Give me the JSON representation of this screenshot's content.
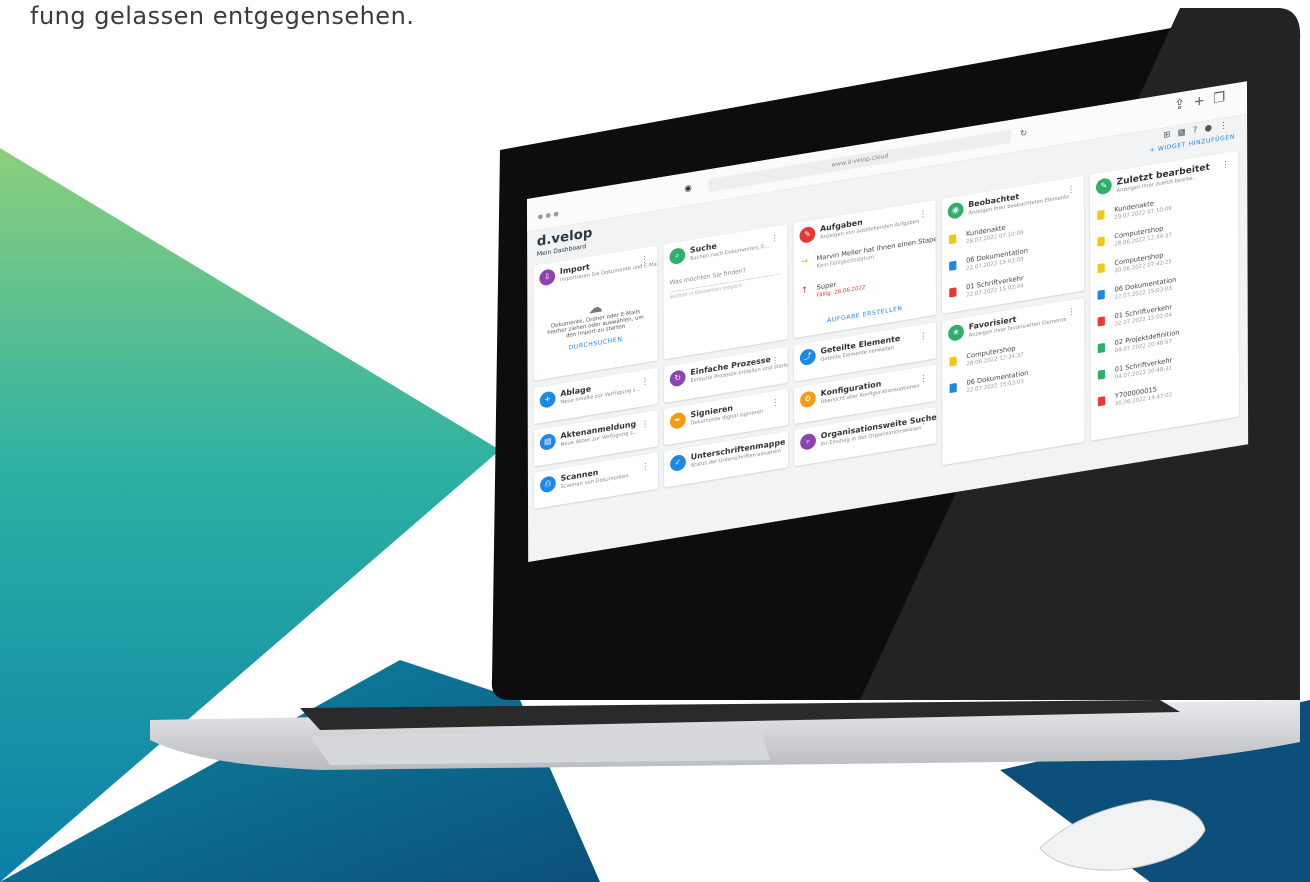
{
  "caption": "fung gelassen entgegensehen.",
  "browser": {
    "url": "www.d-velop.cloud",
    "icons": [
      "share-icon",
      "plus-icon",
      "tabs-icon"
    ]
  },
  "app": {
    "logo": "d.velop",
    "dashboard": "Mein Dashboard",
    "add_widget": "+ WIDGET HINZUFÜGEN",
    "colors": {
      "accent": "#1e88e5",
      "purple": "#8e44ad",
      "green": "#2eaf6a",
      "red": "#e53935",
      "orange": "#f39c12",
      "blue": "#1e88e5"
    }
  },
  "cards": {
    "import": {
      "title": "Import",
      "sub": "Importieren Sie Dokumente und E-Mails in Ihre D...",
      "body": "Dokumente, Ordner oder E-Mails hierher ziehen oder auswählen, um den Import zu starten",
      "link": "DURCHSUCHEN"
    },
    "suche": {
      "title": "Suche",
      "sub": "Suchen nach Dokumenten, E...",
      "placeholder": "Was möchten Sie finden?",
      "hint": "Suchen in Elementen möglich"
    },
    "aufgaben": {
      "title": "Aufgaben",
      "sub": "Anzeigen von ausstehenden Aufgaben",
      "t1": "Marvin Meller hat Ihnen einen Stapel weitergelei...",
      "t1d": "Kein Fälligkeitsdatum",
      "t2": "Super",
      "t2d": "Fällig: 28.06.2022",
      "link": "AUFGABE ERSTELLEN"
    },
    "beobachtet": {
      "title": "Beobachtet",
      "sub": "Anzeigen Ihrer beobachteten Elemente",
      "items": [
        {
          "name": "Kundenakte",
          "date": "28.07.2022 07:10:09"
        },
        {
          "name": "06 Dokumentation",
          "date": "22.07.2022 15:03:03"
        },
        {
          "name": "01 Schriftverkehr",
          "date": "22.07.2022 15:02:04"
        }
      ]
    },
    "zuletzt": {
      "title": "Zuletzt bearbeitet",
      "sub": "Anzeigen Ihrer zuletzt bearbe...",
      "items": [
        {
          "name": "Kundenakte",
          "date": "29.07.2022 07:10:09"
        },
        {
          "name": "Computershop",
          "date": "28.06.2022 12:34:37"
        },
        {
          "name": "Computershop",
          "date": "30.06.2022 07:42:25"
        },
        {
          "name": "06 Dokumentation",
          "date": "22.07.2022 15:03:03"
        },
        {
          "name": "01 Schriftverkehr",
          "date": "22.07.2022 15:02:04"
        },
        {
          "name": "02 Projektdefinition",
          "date": "04.07.2022 20:48:57"
        },
        {
          "name": "01 Schriftverkehr",
          "date": "04.07.2022 20:48:31"
        },
        {
          "name": "Y700000015",
          "date": "30.06.2022 14:47:02"
        }
      ]
    },
    "ablage": {
      "title": "Ablage",
      "sub": "Neue Inhalte zur Verfügung s..."
    },
    "prozesse": {
      "title": "Einfache Prozesse",
      "sub": "Einfache Prozesse erstellen und starten"
    },
    "geteilt": {
      "title": "Geteilte Elemente",
      "sub": "Geteilte Elemente verwalten"
    },
    "favorisiert": {
      "title": "Favorisiert",
      "sub": "Anzeigen Ihrer favorisierten Elemente",
      "items": [
        {
          "name": "Computershop",
          "date": "28.06.2022 12:34:37"
        },
        {
          "name": "06 Dokumentation",
          "date": "22.07.2022 15:03:03"
        }
      ]
    },
    "aktenanmeldung": {
      "title": "Aktenanmeldung",
      "sub": "Neue Akten zur Verfügung s..."
    },
    "signieren": {
      "title": "Signieren",
      "sub": "Dokumente digital signieren"
    },
    "konfiguration": {
      "title": "Konfiguration",
      "sub": "Übersicht aller Konfigurationsoptionen"
    },
    "scannen": {
      "title": "Scannen",
      "sub": "Scannen von Dokumenten"
    },
    "mappe": {
      "title": "Unterschriftenmappe",
      "sub": "Status der Unterschriften einsehen"
    },
    "orgsuche": {
      "title": "Organisationsweite Suche",
      "sub": "Ihr Einstieg in das Organisationswissen"
    }
  }
}
